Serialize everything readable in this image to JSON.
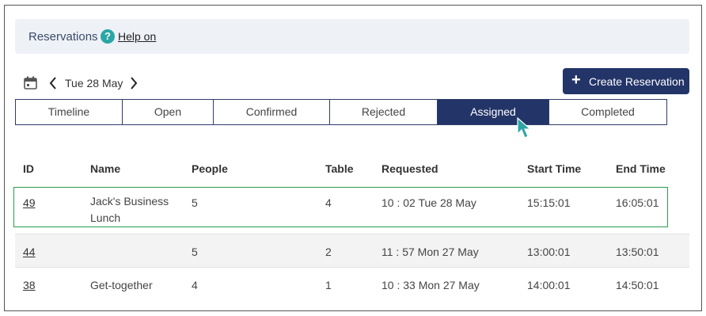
{
  "header": {
    "title": "Reservations",
    "help_icon": "?",
    "help_link": "Help on"
  },
  "date_nav": {
    "date": "Tue 28 May"
  },
  "create_button": {
    "icon": "+",
    "label": "Create Reservation"
  },
  "tabs": [
    {
      "label": "Timeline"
    },
    {
      "label": "Open"
    },
    {
      "label": "Confirmed"
    },
    {
      "label": "Rejected"
    },
    {
      "label": "Assigned"
    },
    {
      "label": "Completed"
    }
  ],
  "active_tab": "Assigned",
  "table": {
    "headers": [
      "ID",
      "Name",
      "People",
      "Table",
      "Requested",
      "Start Time",
      "End Time"
    ],
    "rows": [
      {
        "id": "49",
        "name": "Jack's Business Lunch",
        "people": "5",
        "table": "4",
        "requested": "10 : 02 Tue 28 May",
        "start": "15:15:01",
        "end": "16:05:01"
      },
      {
        "id": "44",
        "name": "",
        "people": "5",
        "table": "2",
        "requested": "11 : 57 Mon 27 May",
        "start": "13:00:01",
        "end": "13:50:01"
      },
      {
        "id": "38",
        "name": "Get-together",
        "people": "4",
        "table": "1",
        "requested": "10 : 33 Mon 27 May",
        "start": "14:00:01",
        "end": "14:50:01"
      }
    ]
  },
  "colors": {
    "accent": "#233468",
    "help": "#2aa6a6",
    "selected_row_border": "#2a9d4f",
    "cursor": "#2aa6a6"
  }
}
